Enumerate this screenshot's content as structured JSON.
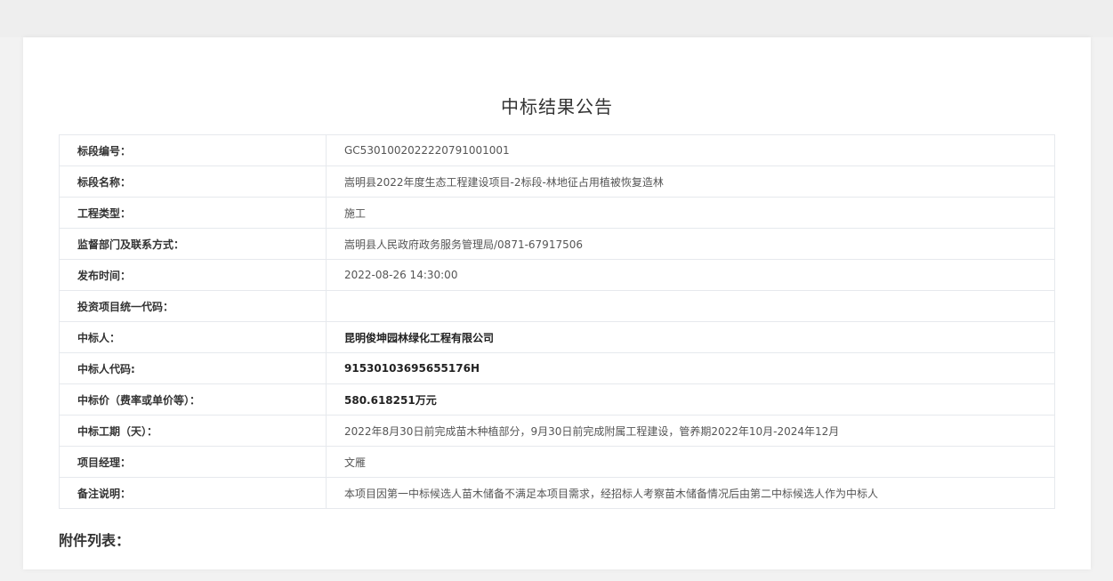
{
  "page_title": "中标结果公告",
  "rows": [
    {
      "label": "标段编号：",
      "value": "GC5301002022220791001001",
      "bold": false
    },
    {
      "label": "标段名称：",
      "value": "嵩明县2022年度生态工程建设项目-2标段-林地征占用植被恢复造林",
      "bold": false
    },
    {
      "label": "工程类型：",
      "value": "施工",
      "bold": false
    },
    {
      "label": "监督部门及联系方式：",
      "value": "嵩明县人民政府政务服务管理局/0871-67917506",
      "bold": false
    },
    {
      "label": "发布时间：",
      "value": "2022-08-26 14:30:00",
      "bold": false
    },
    {
      "label": "投资项目统一代码：",
      "value": "",
      "bold": false
    },
    {
      "label": "中标人：",
      "value": "昆明俊坤园林绿化工程有限公司",
      "bold": true
    },
    {
      "label": "中标人代码:",
      "value": "91530103695655176H",
      "bold": true
    },
    {
      "label": "中标价（费率或单价等）：",
      "value": "580.618251万元",
      "bold": true
    },
    {
      "label": "中标工期（天）：",
      "value": "2022年8月30日前完成苗木种植部分，9月30日前完成附属工程建设，管养期2022年10月-2024年12月",
      "bold": false
    },
    {
      "label": "项目经理：",
      "value": "文雁",
      "bold": false
    },
    {
      "label": "备注说明：",
      "value": "本项目因第一中标候选人苗木储备不满足本项目需求，经招标人考察苗木储备情况后由第二中标候选人作为中标人",
      "bold": false
    }
  ],
  "attachments_label": "附件列表："
}
